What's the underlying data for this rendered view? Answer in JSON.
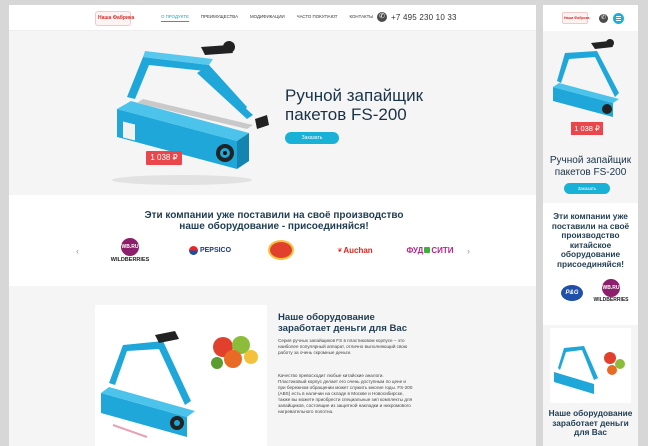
{
  "desktop": {
    "logo_text": "Наша Фабрика",
    "nav": [
      "о продукте",
      "преимущества",
      "модификации",
      "часто покупают",
      "контакты"
    ],
    "phone": "+7 495 230 10 33",
    "hero": {
      "title_line1": "Ручной запайщик",
      "title_line2": "пакетов FS-200",
      "button": "Заказать",
      "price": "1 038 ₽"
    },
    "clients": {
      "title_line1": "Эти компании уже поставили на своё производство",
      "title_line2": "наше оборудование - присоединяйся!",
      "prev": "‹",
      "next": "›",
      "brands": [
        "WB.RU",
        "WILDBERRIES",
        "PEPSICO",
        "Auchan",
        "ФУД",
        "СИТИ"
      ]
    },
    "section2": {
      "title_line1": "Наше оборудование",
      "title_line2": "заработает деньги для Вас",
      "p1": "Серия ручных запайщиков FS в пластиковом корпусе – это наиболее популярный аппарат, отлично выполняющий свою работу за очень скромные деньги.",
      "p2": "Качество превосходит любые китайские аналоги. Пластиковый корпус делает его очень доступным по цене и при бережном обращении может служить многие годы. FS-200 (АВS) есть в наличии на складе в Москве и Новосибирске, также вы можете приобрести специальные зип комплекты для запайщиков, состоящие из защитной накладки и нихромового нагревательного полотна."
    }
  },
  "mobile": {
    "logo_text": "Наша Фабрика",
    "price": "1 038 ₽",
    "title_line1": "Ручной запайщик",
    "title_line2": "пакетов FS-200",
    "button": "Заказать",
    "clients_title": [
      "Эти компании уже",
      "поставили на своё",
      "производство",
      "китайское",
      "оборудование",
      "присоединяйся!"
    ],
    "brands": [
      "P&G",
      "WB.RU",
      "WILDBERRIES"
    ],
    "section_title_line1": "Наше оборудование",
    "section_title_line2": "заработает деньги",
    "section_title_line3": "для Вас"
  },
  "colors": {
    "accent": "#19b1d5",
    "price": "#e9474c",
    "heading": "#1f3d52",
    "device": "#1ea7d8"
  }
}
